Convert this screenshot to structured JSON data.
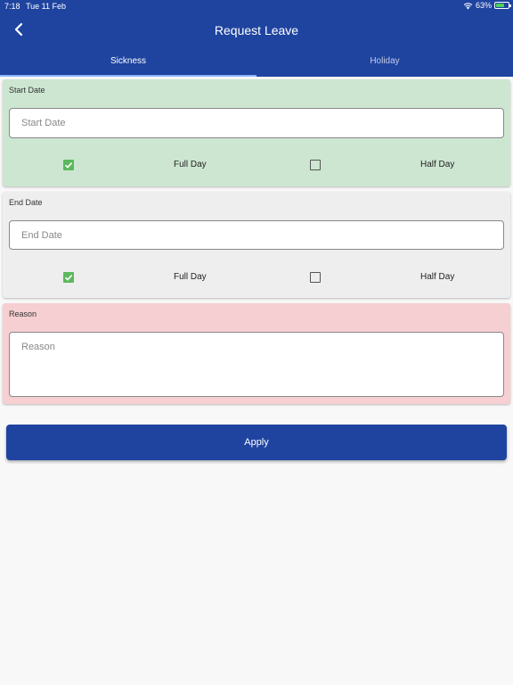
{
  "status_bar": {
    "time": "7:18",
    "date": "Tue 11 Feb",
    "battery": "63%"
  },
  "header": {
    "title": "Request Leave",
    "back_icon": "chevron-left-icon"
  },
  "tabs": [
    {
      "label": "Sickness",
      "active": true
    },
    {
      "label": "Holiday",
      "active": false
    }
  ],
  "start_section": {
    "label": "Start Date",
    "placeholder": "Start Date",
    "background": "#cde6d1",
    "options": [
      {
        "label": "Full Day",
        "checked": true
      },
      {
        "label": "Half Day",
        "checked": false
      }
    ]
  },
  "end_section": {
    "label": "End Date",
    "placeholder": "End Date",
    "background": "#eeeeee",
    "options": [
      {
        "label": "Full Day",
        "checked": true
      },
      {
        "label": "Half Day",
        "checked": false
      }
    ]
  },
  "reason_section": {
    "label": "Reason",
    "placeholder": "Reason",
    "background": "#f6cfd3"
  },
  "apply_button": {
    "label": "Apply"
  },
  "colors": {
    "primary": "#1f44a0",
    "checkbox_checked": "#5cb85c"
  }
}
